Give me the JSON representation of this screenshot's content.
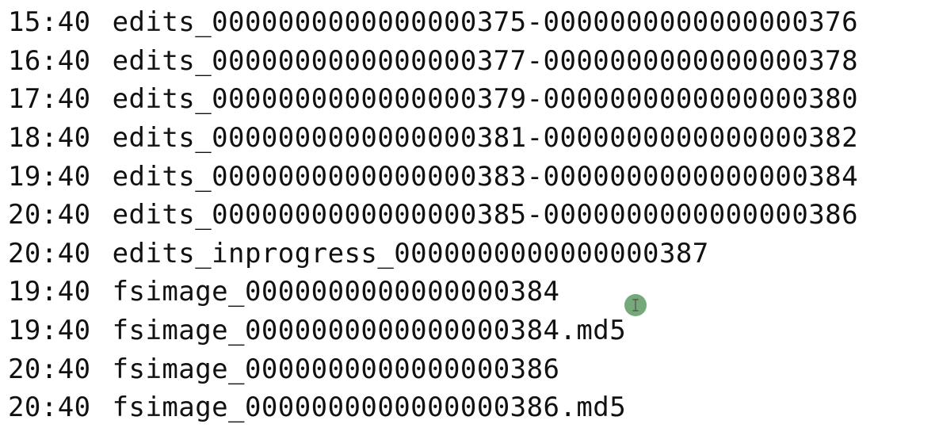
{
  "listing": {
    "rows": [
      {
        "time": "15:40",
        "name": "edits_0000000000000000375-0000000000000000376"
      },
      {
        "time": "16:40",
        "name": "edits_0000000000000000377-0000000000000000378"
      },
      {
        "time": "17:40",
        "name": "edits_0000000000000000379-0000000000000000380"
      },
      {
        "time": "18:40",
        "name": "edits_0000000000000000381-0000000000000000382"
      },
      {
        "time": "19:40",
        "name": "edits_0000000000000000383-0000000000000000384"
      },
      {
        "time": "20:40",
        "name": "edits_0000000000000000385-0000000000000000386"
      },
      {
        "time": "20:40",
        "name": "edits_inprogress_0000000000000000387"
      },
      {
        "time": "19:40",
        "name": "fsimage_0000000000000000384"
      },
      {
        "time": "19:40",
        "name": "fsimage_0000000000000000384.md5"
      },
      {
        "time": "20:40",
        "name": "fsimage_0000000000000000386"
      },
      {
        "time": "20:40",
        "name": "fsimage_0000000000000000386.md5"
      }
    ]
  },
  "cursor": {
    "icon": "text-cursor-icon",
    "color": "#6aa26f"
  }
}
